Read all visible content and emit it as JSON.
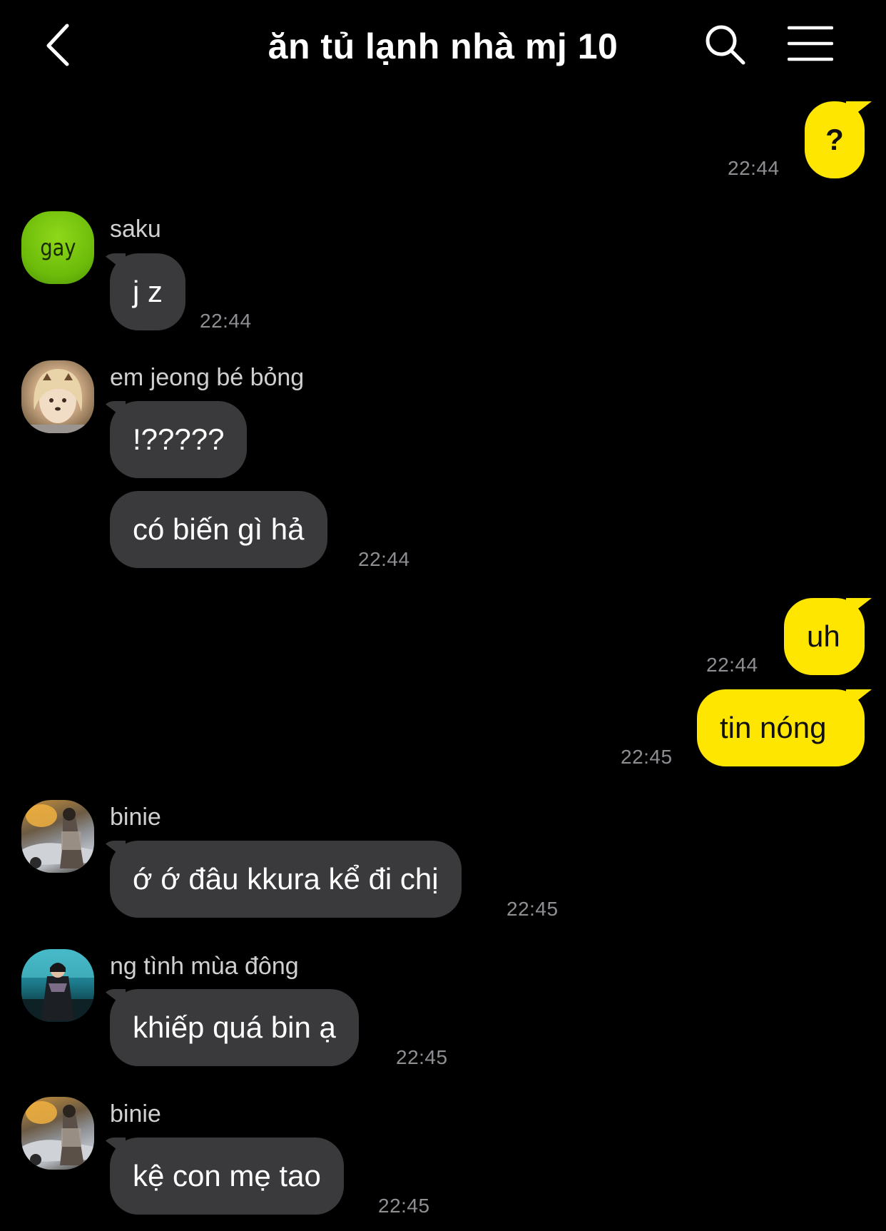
{
  "header": {
    "title": "ăn tủ lạnh nhà mj 10",
    "back_icon": "chevron-left-icon",
    "search_icon": "search-icon",
    "menu_icon": "hamburger-menu-icon"
  },
  "colors": {
    "background": "#000000",
    "my_bubble": "#ffe600",
    "their_bubble": "#3a3a3c",
    "timestamp": "#8e8e93"
  },
  "avatars": {
    "saku_text": "gay"
  },
  "messages": [
    {
      "from": "me",
      "text": "?",
      "time": "22:44"
    },
    {
      "from": "saku",
      "sender": "saku",
      "text": "j z",
      "time": "22:44"
    },
    {
      "from": "jeong",
      "sender": "em jeong bé bỏng",
      "text": "!?????"
    },
    {
      "from": "jeong",
      "text": "có biến gì hả",
      "time": "22:44"
    },
    {
      "from": "me",
      "text": "uh",
      "time": "22:44"
    },
    {
      "from": "me",
      "text": "tin nóng",
      "time": "22:45"
    },
    {
      "from": "binie",
      "sender": "binie",
      "text": "ớ ớ đâu kkura kể đi chị",
      "time": "22:45"
    },
    {
      "from": "ng",
      "sender": "ng tình mùa đông",
      "text": "khiếp quá bin ạ",
      "time": "22:45"
    },
    {
      "from": "binie",
      "sender": "binie",
      "text": "kệ con mẹ tao",
      "time": "22:45"
    }
  ]
}
